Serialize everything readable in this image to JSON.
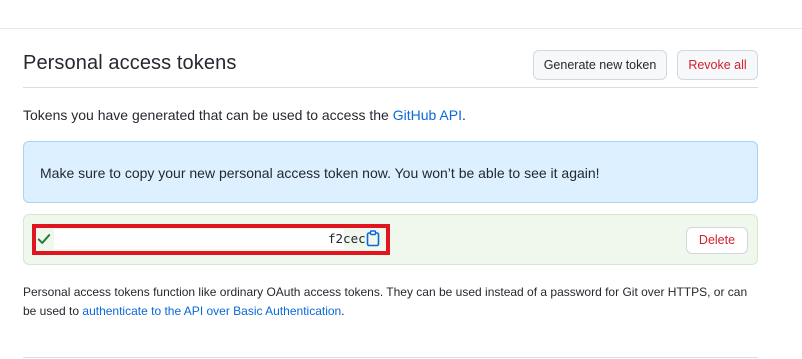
{
  "header": {
    "title": "Personal access tokens",
    "generate_label": "Generate new token",
    "revoke_label": "Revoke all"
  },
  "intro": {
    "text": "Tokens you have generated that can be used to access the ",
    "link": "GitHub API",
    "suffix": "."
  },
  "flash": {
    "message": "Make sure to copy your new personal access token now. You won’t be able to see it again!"
  },
  "token": {
    "value_tail": "f2cec",
    "delete_label": "Delete",
    "icons": [
      "check-icon",
      "clipboard-icon"
    ]
  },
  "footnote": {
    "text": "Personal access tokens function like ordinary OAuth access tokens. They can be used instead of a password for Git over HTTPS, or can be used to ",
    "link": "authenticate to the API over Basic Authentication",
    "suffix": "."
  },
  "colors": {
    "link": "#0969da",
    "danger": "#cf222e",
    "flash_bg": "#ddf0ff",
    "token_bg": "#f0f7ec",
    "redaction": "#e0161f"
  }
}
